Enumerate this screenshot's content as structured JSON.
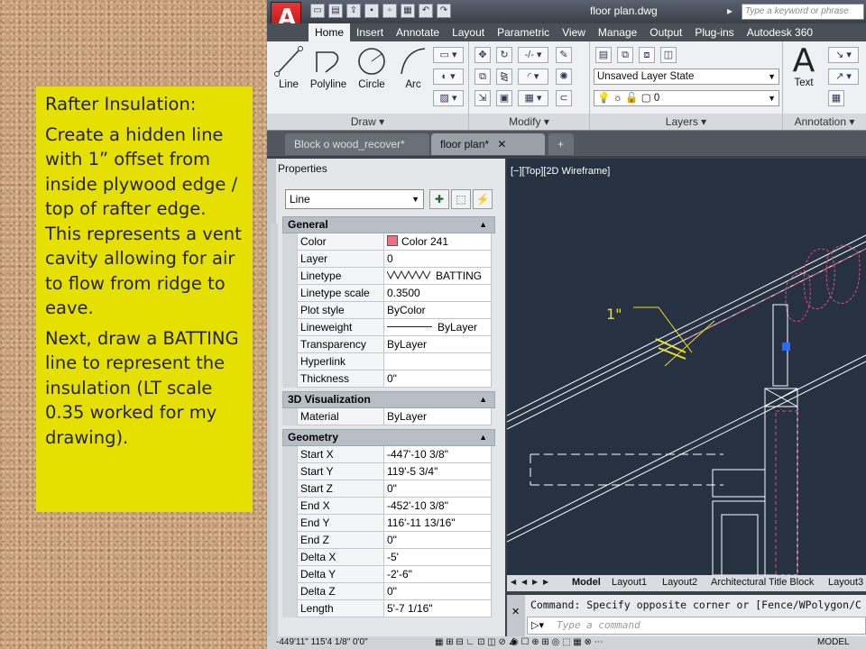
{
  "note": {
    "p1": "Rafter Insulation:",
    "p2": "Create a hidden line with 1” offset from inside plywood edge / top of rafter edge. This represents a vent cavity allowing for air to flow from ridge to eave.",
    "p3": "Next, draw a BATTING line to represent the insulation (LT scale 0.35 worked for my drawing)."
  },
  "app": {
    "logo": "A",
    "title": "floor plan.dwg",
    "search_placeholder": "Type a keyword or phrase",
    "tabs": [
      "Home",
      "Insert",
      "Annotate",
      "Layout",
      "Parametric",
      "View",
      "Manage",
      "Output",
      "Plug-ins",
      "Autodesk 360"
    ],
    "active_tab": "Home"
  },
  "ribbon": {
    "draw_tools": [
      "Line",
      "Polyline",
      "Circle",
      "Arc"
    ],
    "draw_title": "Draw",
    "modify_title": "Modify",
    "layer_state": "Unsaved Layer State",
    "layer_current": "0",
    "layers_title": "Layers",
    "text_tool": "Text",
    "text_glyph": "A",
    "annotation_title": "Annotation"
  },
  "doc_tabs": [
    "Block o wood_recover*",
    "floor plan*"
  ],
  "properties": {
    "title": "Properties",
    "object_type": "Line",
    "sections": {
      "general": "General",
      "viz": "3D Visualization",
      "geometry": "Geometry"
    },
    "general_rows": [
      {
        "k": "Color",
        "v": "Color 241"
      },
      {
        "k": "Layer",
        "v": "0"
      },
      {
        "k": "Linetype",
        "v": "BATTING"
      },
      {
        "k": "Linetype scale",
        "v": "0.3500"
      },
      {
        "k": "Plot style",
        "v": "ByColor"
      },
      {
        "k": "Lineweight",
        "v": "ByLayer"
      },
      {
        "k": "Transparency",
        "v": "ByLayer"
      },
      {
        "k": "Hyperlink",
        "v": ""
      },
      {
        "k": "Thickness",
        "v": "0\""
      }
    ],
    "viz_rows": [
      {
        "k": "Material",
        "v": "ByLayer"
      }
    ],
    "geometry_rows": [
      {
        "k": "Start X",
        "v": "-447'-10 3/8\""
      },
      {
        "k": "Start Y",
        "v": "119'-5 3/4\""
      },
      {
        "k": "Start Z",
        "v": "0\""
      },
      {
        "k": "End X",
        "v": "-452'-10 3/8\""
      },
      {
        "k": "End Y",
        "v": "116'-11 13/16\""
      },
      {
        "k": "End Z",
        "v": "0\""
      },
      {
        "k": "Delta X",
        "v": "-5'"
      },
      {
        "k": "Delta Y",
        "v": "-2'-6\""
      },
      {
        "k": "Delta Z",
        "v": "0\""
      },
      {
        "k": "Length",
        "v": "5'-7 1/16\""
      }
    ]
  },
  "viewport": {
    "label": "[−][Top][2D Wireframe]",
    "dim_text": "1\""
  },
  "layout_tabs": [
    "Model",
    "Layout1",
    "Layout2",
    "Architectural Title Block",
    "Layout3"
  ],
  "command": {
    "history": "Command: Specify opposite corner or [Fence/WPolygon/C",
    "placeholder": "Type a command"
  },
  "status": {
    "coords": "-449'11\"  115'4 1/8\"  0'0\"",
    "model": "MODEL"
  },
  "colors": {
    "note_bg": "#e6e000",
    "canvas_bg": "#263142",
    "batting_pink": "#e0507a",
    "dim_yellow": "#f0e020",
    "grip_blue": "#2a6cf0"
  }
}
